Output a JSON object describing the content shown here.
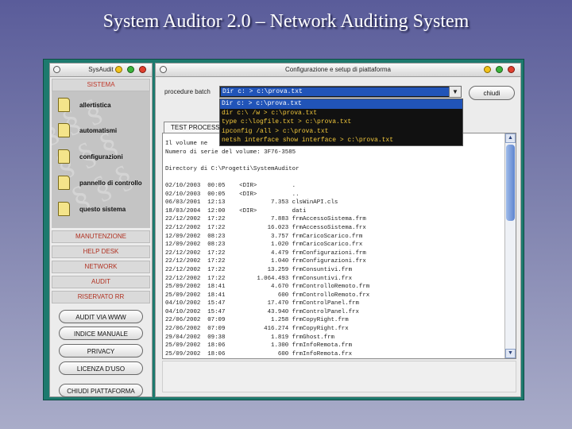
{
  "slide": {
    "title": "System Auditor 2.0 – Network Auditing System"
  },
  "left_window": {
    "title": "SysAudit",
    "section": "SISTEMA",
    "items": [
      {
        "label": "allertistica"
      },
      {
        "label": "automatismi"
      },
      {
        "label": "configurazioni"
      },
      {
        "label": "pannello di controllo"
      },
      {
        "label": "questo sistema"
      }
    ],
    "bands": [
      "MANUTENZIONE",
      "HELP DESK",
      "NETWORK",
      "AUDIT",
      "RISERVATO RR"
    ],
    "buttons": [
      "AUDIT VIA WWW",
      "INDICE MANUALE",
      "PRIVACY",
      "LICENZA D'USO",
      "CHIUDI PIATTAFORMA"
    ]
  },
  "right_window": {
    "title": "Configurazione e setup di piattaforma",
    "batch_label": "procedure batch",
    "combo_value": "Dir c: > c:\\prova.txt",
    "dropdown_options": [
      "Dir c: > c:\\prova.txt",
      "dir c:\\ /w > c:\\prova.txt",
      "type c:\\logfile.txt > c:\\prova.txt",
      "ipconfig /all > c:\\prova.txt",
      "netsh  interface show  interface > c:\\prova.txt"
    ],
    "close_button": "chiudi",
    "test_tab": "TEST PROCESS",
    "output_lines": [
      "Il volume ne",
      "Numero di serie del volume: 3F76-3585",
      "",
      "Directory di C:\\Progetti\\SystemAuditor",
      "",
      "02/10/2003  00:05    <DIR>          .",
      "02/10/2003  00:05    <DIR>          ..",
      "06/03/2001  12:13             7.353 clsWinAPI.cls",
      "18/03/2004  12:00    <DIR>          dati",
      "22/12/2002  17:22             7.883 frmAccessoSistema.frm",
      "22/12/2002  17:22            16.023 frmAccessoSistema.frx",
      "12/09/2002  08:23             3.757 frmCaricoScarico.frm",
      "12/09/2002  08:23             1.020 frmCaricoScarico.frx",
      "22/12/2002  17:22             4.479 frmConfigurazioni.frm",
      "22/12/2002  17:22             1.040 frmConfigurazioni.frx",
      "22/12/2002  17:22            13.259 frmConsuntivi.frm",
      "22/12/2002  17:22         1.064.493 frmConsuntivi.frx",
      "25/09/2002  18:41             4.670 frmControlloRemoto.frm",
      "25/09/2002  18:41               600 frmControlloRemoto.frx",
      "04/10/2002  15:47            17.470 frmControlPanel.frm",
      "04/10/2002  15:47            43.940 frmControlPanel.frx",
      "22/06/2002  07:09             1.258 frmCopyRight.frm",
      "22/06/2002  07:09           416.274 frmCopyRight.frx",
      "29/04/2002  09:38             1.819 frmGhost.frm",
      "25/09/2002  18:06             1.300 frmInfoRemota.frm",
      "25/09/2002  18:06               600 frmInfoRemota.frx"
    ]
  }
}
